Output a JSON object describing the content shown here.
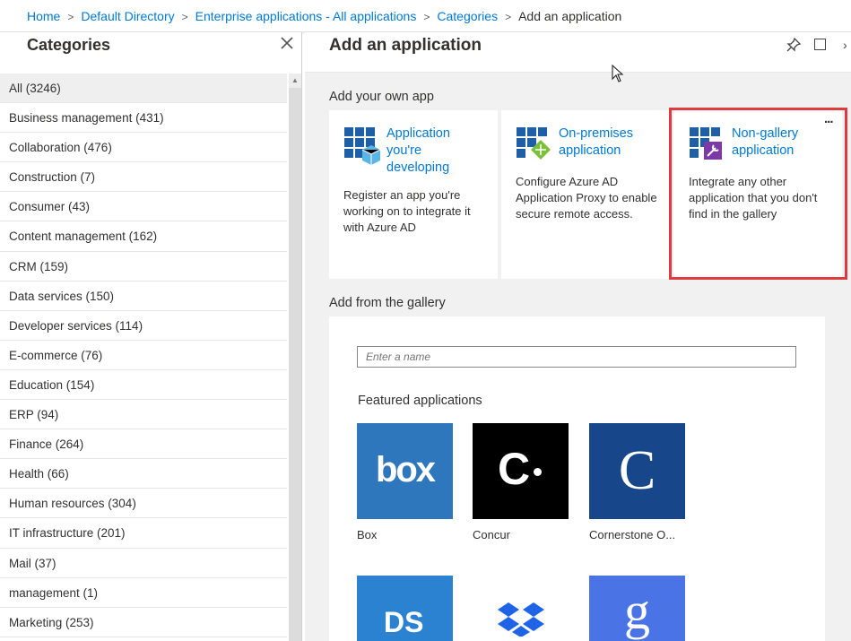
{
  "breadcrumb": {
    "items": [
      "Home",
      "Default Directory",
      "Enterprise applications - All applications",
      "Categories"
    ],
    "current": "Add an application"
  },
  "categories_blade": {
    "title": "Categories",
    "items": [
      "All (3246)",
      "Business management (431)",
      "Collaboration (476)",
      "Construction (7)",
      "Consumer (43)",
      "Content management (162)",
      "CRM (159)",
      "Data services (150)",
      "Developer services (114)",
      "E-commerce (76)",
      "Education (154)",
      "ERP (94)",
      "Finance (264)",
      "Health (66)",
      "Human resources (304)",
      "IT infrastructure (201)",
      "Mail (37)",
      "management (1)",
      "Marketing (253)"
    ],
    "selected_index": 0
  },
  "add_app_blade": {
    "title": "Add an application",
    "own_app_label": "Add your own app",
    "tiles": [
      {
        "title_lines": [
          "Application",
          "you're",
          "developing"
        ],
        "description": "Register an app you're working on to integrate it with Azure AD",
        "icon": "app-grid-cube-icon"
      },
      {
        "title_lines": [
          "On-premises",
          "application"
        ],
        "description": "Configure Azure AD Application Proxy to enable secure remote access.",
        "icon": "app-grid-proxy-icon"
      },
      {
        "title_lines": [
          "Non-gallery",
          "application"
        ],
        "description": "Integrate any other application that you don't find in the gallery",
        "icon": "app-grid-wrench-icon",
        "highlighted": true
      }
    ],
    "tile_more_label": "...",
    "gallery_label": "Add from the gallery",
    "search_placeholder": "Enter a name",
    "featured_label": "Featured applications",
    "featured_apps": [
      {
        "name": "Box",
        "logo_text": "box",
        "color": "#2f77bc"
      },
      {
        "name": "Concur",
        "logo_text": "C",
        "color": "#000000"
      },
      {
        "name": "Cornerstone O...",
        "logo_text": "C",
        "color": "#17468a"
      },
      {
        "name": "",
        "logo_text": "DS",
        "color": "#2a82d0"
      },
      {
        "name": "",
        "logo_text": "",
        "color": "#ffffff"
      },
      {
        "name": "",
        "logo_text": "g",
        "color": "#4a74e6"
      }
    ]
  },
  "colors": {
    "link": "#0078d4",
    "highlight_border": "#e0393e",
    "blade_background": "#f1f1f1"
  }
}
